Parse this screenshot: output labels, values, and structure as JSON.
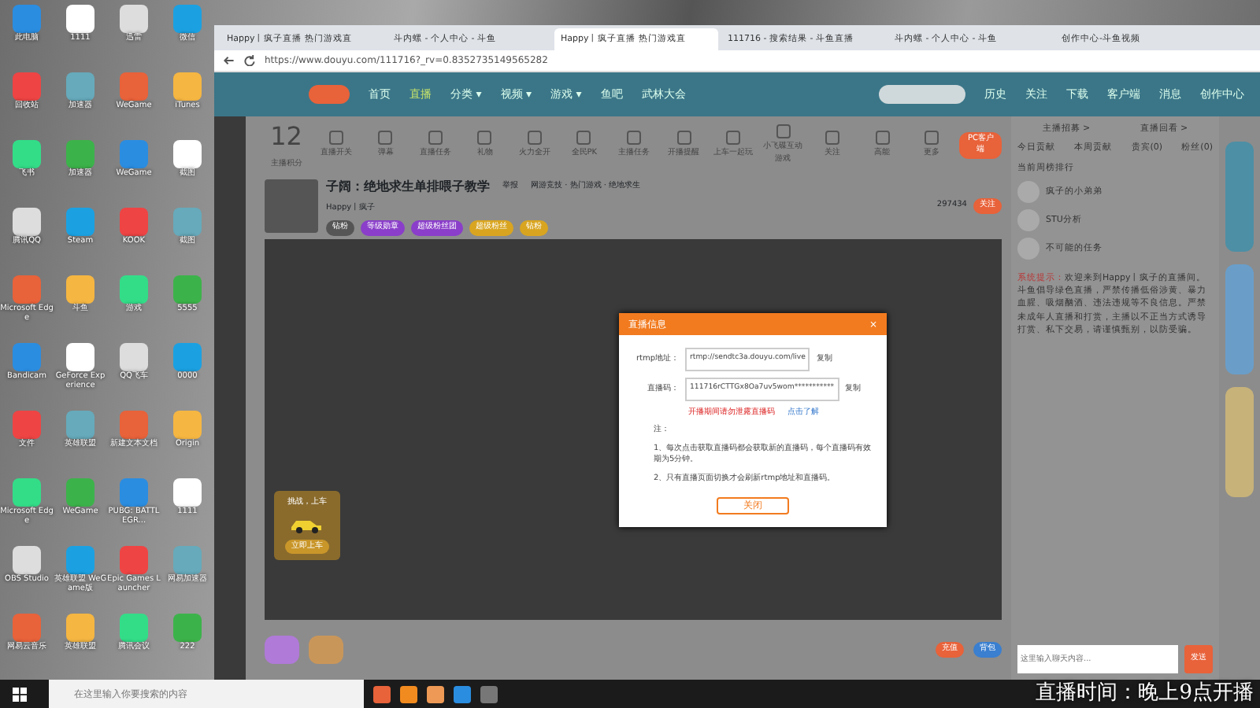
{
  "desktop": {
    "icons": [
      {
        "label": "此电脑"
      },
      {
        "label": "1111"
      },
      {
        "label": "迅雷"
      },
      {
        "label": "微信"
      },
      {
        "label": "回收站"
      },
      {
        "label": "加速器"
      },
      {
        "label": "WeGame"
      },
      {
        "label": "iTunes"
      },
      {
        "label": "飞书"
      },
      {
        "label": "加速器"
      },
      {
        "label": "WeGame"
      },
      {
        "label": "截图"
      },
      {
        "label": "腾讯QQ"
      },
      {
        "label": "Steam"
      },
      {
        "label": "KOOK"
      },
      {
        "label": "截图"
      },
      {
        "label": "Microsoft Edge"
      },
      {
        "label": "斗鱼"
      },
      {
        "label": "游戏"
      },
      {
        "label": "5555"
      },
      {
        "label": "Bandicam"
      },
      {
        "label": "GeForce Experience"
      },
      {
        "label": "QQ飞车"
      },
      {
        "label": "0000"
      },
      {
        "label": "文件"
      },
      {
        "label": "英雄联盟"
      },
      {
        "label": "新建文本文档"
      },
      {
        "label": "Origin"
      },
      {
        "label": "Microsoft Edge"
      },
      {
        "label": "WeGame"
      },
      {
        "label": "PUBG: BATTLEGR..."
      },
      {
        "label": "1111"
      },
      {
        "label": "OBS Studio"
      },
      {
        "label": "英雄联盟 WeGame版"
      },
      {
        "label": "Epic Games Launcher"
      },
      {
        "label": "网易加速器"
      },
      {
        "label": "网易云音乐"
      },
      {
        "label": "英雄联盟"
      },
      {
        "label": "腾讯会议"
      },
      {
        "label": "222"
      }
    ]
  },
  "browser": {
    "tabs": [
      {
        "title": "Happy丨疯子直播 热门游戏直",
        "selected": false
      },
      {
        "title": "斗内螺 - 个人中心 - 斗鱼",
        "selected": false
      },
      {
        "title": "Happy丨疯子直播 热门游戏直",
        "selected": true
      },
      {
        "title": "111716 - 搜索结果 - 斗鱼直播",
        "selected": false
      },
      {
        "title": "斗内螺 - 个人中心 - 斗鱼",
        "selected": false
      },
      {
        "title": "创作中心-斗鱼视频",
        "selected": false
      }
    ],
    "url": "https://www.douyu.com/111716?_rv=0.8352735149565282"
  },
  "site_header": {
    "nav": [
      {
        "label": "首页",
        "selected": false
      },
      {
        "label": "直播",
        "selected": true
      },
      {
        "label": "分类 ▾",
        "selected": false
      },
      {
        "label": "视频 ▾",
        "selected": false
      },
      {
        "label": "游戏 ▾",
        "selected": false
      },
      {
        "label": "鱼吧",
        "selected": false
      },
      {
        "label": "武林大会",
        "selected": false
      }
    ],
    "actions": [
      "历史",
      "关注",
      "下载",
      "客户端",
      "消息",
      "创作中心"
    ]
  },
  "toolbar": {
    "score": "12",
    "score_label": "主播积分",
    "items": [
      "直播开关",
      "弹幕",
      "直播任务",
      "礼物",
      "火力全开",
      "全民PK",
      "主播任务",
      "开播提醒",
      "上车一起玩",
      "小飞碟互动游戏",
      "关注",
      "高能",
      "更多"
    ],
    "client_button": "PC客户端"
  },
  "room": {
    "title": "子阔：绝地求生单排喂子教学",
    "report": "举报",
    "category": "网游竞技 · 热门游戏 · 绝地求生",
    "anchor": "Happy丨疯子",
    "followers": "297434",
    "follow": "关注",
    "tags": [
      "钻粉",
      "等级勋章",
      "超级粉丝团",
      "超级粉丝",
      "钻粉"
    ]
  },
  "chat": {
    "links": [
      "主播招募 >",
      "直播回看 >"
    ],
    "tabs": [
      "今日贡献",
      "本周贡献",
      "贵宾(0)",
      "粉丝(0)"
    ],
    "rank_title": "当前周榜排行",
    "ranking": [
      {
        "name": "疯子的小弟弟"
      },
      {
        "name": "STU分析"
      },
      {
        "name": "不可能的任务"
      }
    ],
    "notice_label": "系统提示：",
    "notice": "欢迎来到Happy丨疯子的直播间。斗鱼倡导绿色直播，严禁传播低俗涉黄、暴力血腥、吸烟酗酒、违法违规等不良信息。严禁未成年人直播和打赏，主播以不正当方式诱导打赏、私下交易，请谨慎甄别，以防受骗。"
  },
  "video_card": {
    "title": "挑战，上车",
    "button": "立即上车"
  },
  "gift_bar": {
    "buttons": [
      "充值",
      "背包"
    ]
  },
  "chat_input": {
    "placeholder": "这里输入聊天内容...",
    "send": "发送"
  },
  "dialog": {
    "title": "直播信息",
    "close": "×",
    "rtmp_label": "rtmp地址：",
    "rtmp_value": "rtmp://sendtc3a.douyu.com/live",
    "code_label": "直播码：",
    "code_value": "111716rCTTGx8Oa7uv5wom***********",
    "rtmp_copy": "复制",
    "code_copy": "复制",
    "warning": "开播期间请勿泄露直播码",
    "learn_more": "点击了解",
    "note_title": "注：",
    "notes": [
      "1、每次点击获取直播码都会获取新的直播码，每个直播码有效期为5分钟。",
      "2、只有直播页面切换才会刷新rtmp地址和直播码。"
    ],
    "ok": "关闭"
  },
  "taskbar": {
    "search_placeholder": "在这里输入你要搜索的内容"
  },
  "stream_overlay": "直播时间：晚上9点开播"
}
